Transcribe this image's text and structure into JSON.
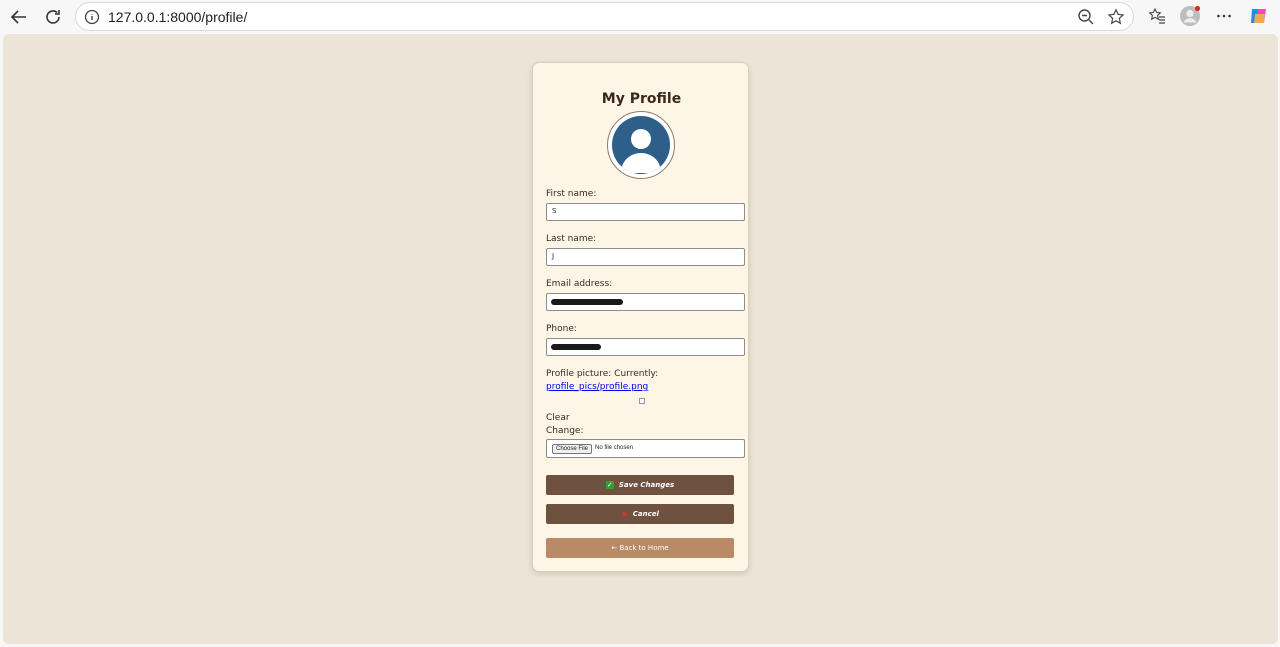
{
  "browser": {
    "url": "127.0.0.1:8000/profile/"
  },
  "card": {
    "title": "My Profile",
    "fields": [
      {
        "label": "First name:",
        "value": "S"
      },
      {
        "label": "Last name:",
        "value": "J"
      },
      {
        "label": "Email address:",
        "value": ""
      },
      {
        "label": "Phone:",
        "value": ""
      }
    ],
    "picture_label": "Profile picture: Currently:",
    "picture_link": "profile_pics/profile.png",
    "clear_label": "Clear",
    "change_label": "Change:",
    "choose_file": "Choose File",
    "no_file": "No file chosen",
    "save_label": "Save Changes",
    "cancel_label": "Cancel",
    "home_label": "← Back to Home"
  },
  "colors": {
    "page_bg": "#ece4d6",
    "card_bg": "#fdf5e6",
    "primary_button": "#6f5140",
    "secondary_button": "#b88a65",
    "avatar": "#2e5f8a"
  },
  "icons": [
    "back-arrow-icon",
    "refresh-icon",
    "info-icon",
    "zoom-out-icon",
    "star-icon",
    "favorites-icon",
    "profile-avatar-icon",
    "more-icon",
    "copilot-icon",
    "check-icon",
    "cross-icon"
  ]
}
